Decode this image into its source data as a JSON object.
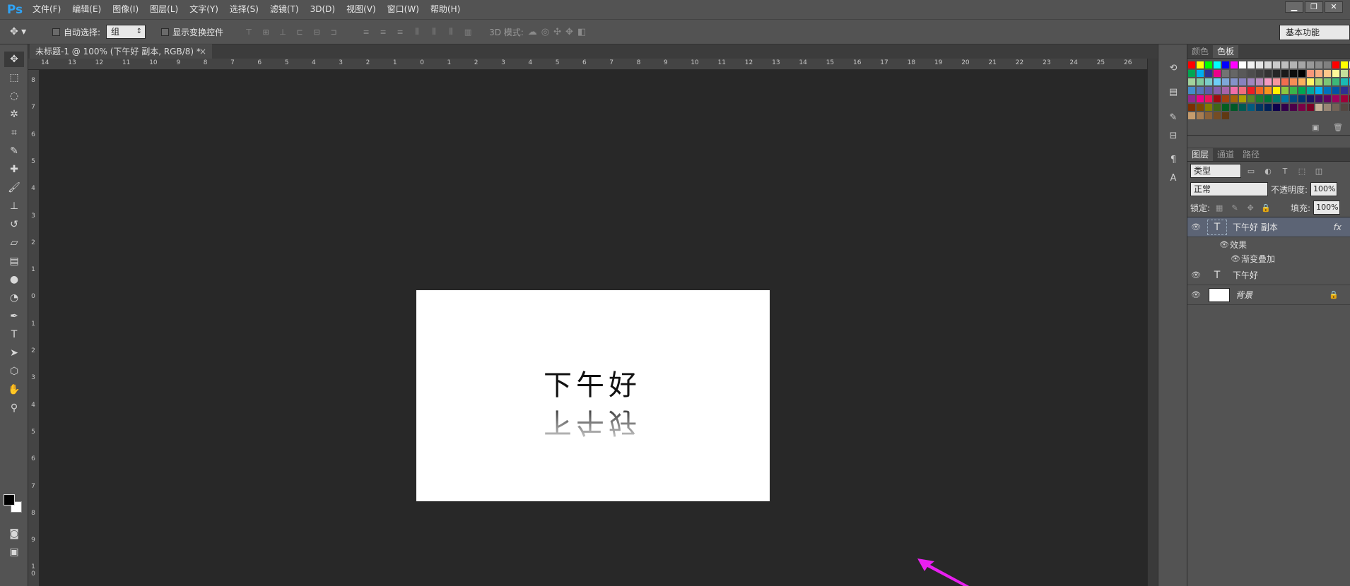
{
  "app": {
    "logo": "Ps"
  },
  "menu": [
    "文件(F)",
    "编辑(E)",
    "图像(I)",
    "图层(L)",
    "文字(Y)",
    "选择(S)",
    "滤镜(T)",
    "3D(D)",
    "视图(V)",
    "窗口(W)",
    "帮助(H)"
  ],
  "window_buttons": {
    "minimize": "▁",
    "restore": "❐",
    "close": "✕"
  },
  "options": {
    "auto_select_label": "自动选择:",
    "auto_select_value": "组",
    "show_transform_label": "显示变换控件",
    "mode3d_label": "3D 模式:",
    "workspace": "基本功能"
  },
  "document_tab": {
    "title": "未标题-1 @ 100% (下午好 副本, RGB/8) *",
    "close": "×"
  },
  "ruler_h": [
    "14",
    "13",
    "12",
    "11",
    "10",
    "9",
    "8",
    "7",
    "6",
    "5",
    "4",
    "3",
    "2",
    "1",
    "0",
    "1",
    "2",
    "3",
    "4",
    "5",
    "6",
    "7",
    "8",
    "9",
    "10",
    "11",
    "12",
    "13",
    "14",
    "15",
    "16",
    "17",
    "18",
    "19",
    "20",
    "21",
    "22",
    "23",
    "24",
    "25",
    "26",
    "2"
  ],
  "ruler_v": [
    "8",
    "7",
    "6",
    "5",
    "4",
    "3",
    "2",
    "1",
    "0",
    "1",
    "2",
    "3",
    "4",
    "5",
    "6",
    "7",
    "8",
    "9",
    "1 0"
  ],
  "canvas": {
    "text": "下午好",
    "reflection": "下午好"
  },
  "colors": {
    "arrow": "#e81ff0",
    "selected_layer": "#5c6475"
  },
  "swatch_panel": {
    "tabs": [
      "颜色",
      "色板"
    ]
  },
  "swatch_colors": [
    "#ff0000",
    "#ffff00",
    "#00ff00",
    "#00ffff",
    "#0000ff",
    "#ff00ff",
    "#ffffff",
    "#f2f2f2",
    "#e6e6e6",
    "#d9d9d9",
    "#cccccc",
    "#bfbfbf",
    "#b3b3b3",
    "#a6a6a6",
    "#999999",
    "#8c8c8c",
    "#808080",
    "#ff0000",
    "#ffff00",
    "#ffffff",
    "#00a651",
    "#00aeef",
    "#2e3192",
    "#ec008c",
    "#737373",
    "#666666",
    "#595959",
    "#4d4d4d",
    "#404040",
    "#333333",
    "#262626",
    "#1a1a1a",
    "#0d0d0d",
    "#000000",
    "#f7977a",
    "#f9ad81",
    "#fdc68a",
    "#fff79a",
    "#c4df9b",
    "#f26c4f",
    "#a3d39c",
    "#82ca9d",
    "#7bcdc8",
    "#6ecff6",
    "#7ea7d8",
    "#8493ca",
    "#8882be",
    "#a187be",
    "#bc8dbf",
    "#f49ac2",
    "#f6989d",
    "#f26c4f",
    "#f68e56",
    "#fbaf5d",
    "#fff467",
    "#acd372",
    "#7cc576",
    "#3bb878",
    "#1abbb4",
    "#00bff3",
    "#438ccb",
    "#5574b9",
    "#605ca8",
    "#855fa8",
    "#a763a8",
    "#f06eaa",
    "#f26d7d",
    "#ed1c24",
    "#f26522",
    "#f7941d",
    "#fff200",
    "#8dc73f",
    "#39b54a",
    "#00a651",
    "#00a99d",
    "#00aeef",
    "#0072bc",
    "#0054a6",
    "#2e3192",
    "#662d91",
    "#92278f",
    "#ec008c",
    "#ed145b",
    "#9e0b0f",
    "#a0410d",
    "#a3620a",
    "#aba000",
    "#598527",
    "#1a7b30",
    "#007236",
    "#00746b",
    "#0076a3",
    "#004b80",
    "#003471",
    "#1b1464",
    "#440e62",
    "#630460",
    "#9e005d",
    "#9e0039",
    "#790000",
    "#7b2e00",
    "#7d4900",
    "#827b00",
    "#406618",
    "#005e20",
    "#005826",
    "#005952",
    "#005b7f",
    "#003663",
    "#002157",
    "#0d004c",
    "#32004b",
    "#4b0049",
    "#7b0046",
    "#7a0026",
    "#c7b299",
    "#998675",
    "#736357",
    "#534741",
    "#37302d",
    "#c69c6d",
    "#a67c52",
    "#8c6239",
    "#754c24",
    "#603913"
  ],
  "layers_panel": {
    "tabs": [
      "图层",
      "通道",
      "路径"
    ],
    "filter": "类型",
    "blend_mode": "正常",
    "opacity_label": "不透明度:",
    "opacity": "100%",
    "lock_label": "锁定:",
    "fill_label": "填充:",
    "fill": "100%",
    "layers": [
      {
        "name": "下午好 副本",
        "type_icon": "T",
        "fx": "fx",
        "effects_label": "效果",
        "effect": "渐变叠加"
      },
      {
        "name": "下午好",
        "type_icon": "T"
      },
      {
        "name": "背景"
      }
    ]
  }
}
